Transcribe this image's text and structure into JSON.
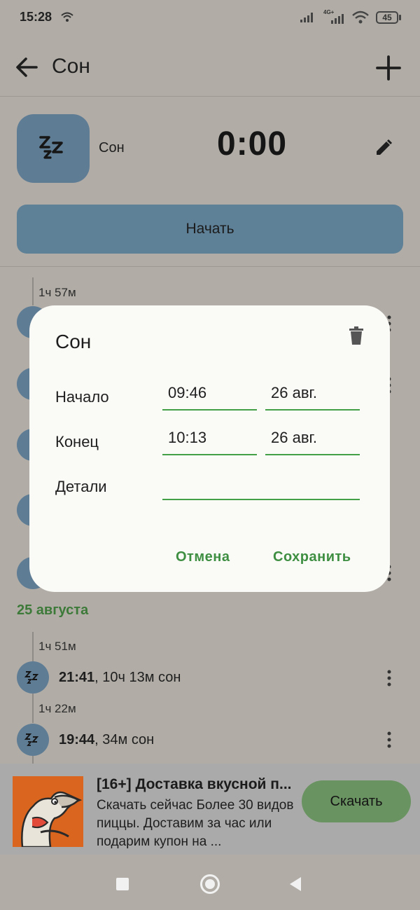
{
  "status_bar": {
    "time": "15:28",
    "battery": "45",
    "network": "4G+"
  },
  "app_bar": {
    "title": "Сон",
    "back_icon": "arrow-left-icon",
    "add_icon": "plus-icon"
  },
  "header": {
    "category_label": "Сон",
    "timer": "0:00",
    "start_label": "Начать",
    "icon": "zz-sleep-icon"
  },
  "timeline": {
    "top_items": [
      {
        "duration": "1ч 57м"
      }
    ],
    "date_group": "25 августа",
    "items": [
      {
        "duration": "1ч 51м",
        "time": "21:41",
        "rest": ", 10ч 13м сон"
      },
      {
        "duration": "1ч 22м",
        "time": "19:44",
        "rest": ", 34м сон"
      }
    ]
  },
  "dialog": {
    "title": "Сон",
    "start_label": "Начало",
    "start_time": "09:46",
    "start_date": "26 авг.",
    "end_label": "Конец",
    "end_time": "10:13",
    "end_date": "26 авг.",
    "details_label": "Детали",
    "details_value": "",
    "cancel_label": "Отмена",
    "save_label": "Сохранить"
  },
  "ad": {
    "title": "[16+] Доставка вкусной п...",
    "description": "Скачать сейчас Более 30 видов пиццы. Доставим за час или подарим купон на ...",
    "button_label": "Скачать"
  },
  "colors": {
    "accent": "#3f8f43",
    "category": "#5f7c95",
    "scrim": "#b1ada6"
  }
}
